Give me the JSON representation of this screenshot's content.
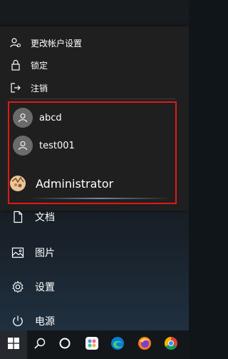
{
  "account_menu": {
    "change_settings": "更改帐户设置",
    "lock": "锁定",
    "sign_out": "注销"
  },
  "users": [
    {
      "name": "abcd"
    },
    {
      "name": "test001"
    }
  ],
  "current_user": {
    "name": "Administrator"
  },
  "menu": {
    "documents": "文档",
    "pictures": "图片",
    "settings": "设置",
    "power": "电源"
  },
  "colors": {
    "highlight_border": "#e01919",
    "flyout_bg": "#1f1f1f",
    "taskbar_bg": "#14171a"
  },
  "taskbar": {
    "icons": [
      "windows-start-icon",
      "search-icon",
      "cortana-icon",
      "app-icon",
      "edge-icon",
      "firefox-icon",
      "chrome-icon"
    ]
  }
}
